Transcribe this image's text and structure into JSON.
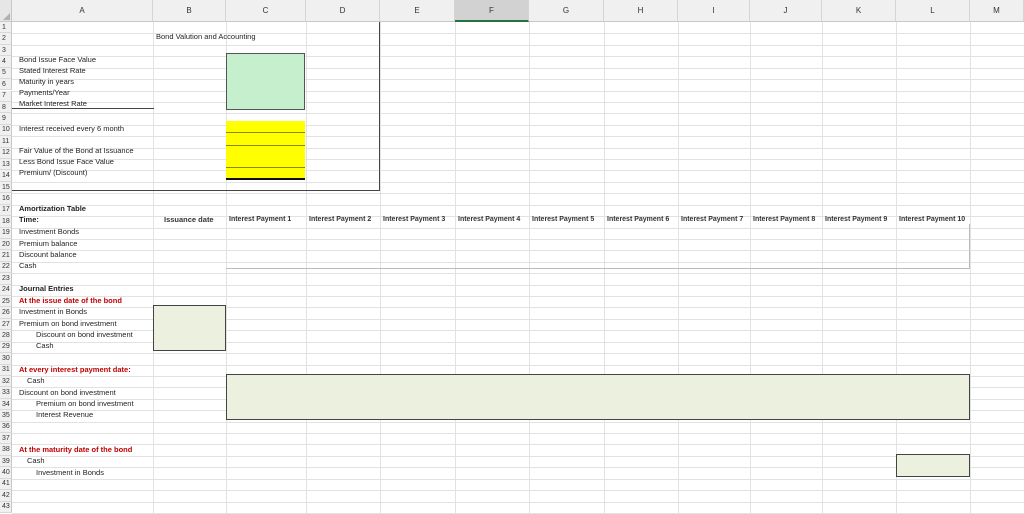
{
  "columns": [
    "A",
    "B",
    "C",
    "D",
    "E",
    "F",
    "G",
    "H",
    "I",
    "J",
    "K",
    "L",
    "M"
  ],
  "selected_column": "F",
  "rows": [
    "1",
    "2",
    "3",
    "4",
    "5",
    "6",
    "7",
    "8",
    "9",
    "10",
    "11",
    "12",
    "13",
    "14",
    "15",
    "16",
    "17",
    "18",
    "19",
    "20",
    "21",
    "22",
    "23",
    "24",
    "25",
    "26",
    "27",
    "28",
    "29",
    "30",
    "31",
    "32",
    "33",
    "34",
    "35",
    "36",
    "37",
    "38",
    "39",
    "40",
    "41",
    "42",
    "43"
  ],
  "sheet": {
    "title": "Bond Valution and Accounting",
    "inputs": {
      "face_value_label": "Bond Issue Face Value",
      "stated_rate_label": "Stated Interest Rate",
      "maturity_label": "Maturity in years",
      "payments_label": "Payments/Year",
      "market_rate_label": "Market Interest Rate"
    },
    "calcs": {
      "interest_label": "Interest received every 6 month",
      "fair_value_label": "Fair Value of the Bond at Issuance",
      "less_face_label": "Less Bond Issue Face Value",
      "premium_label": "Premium/ (Discount)"
    },
    "amortization": {
      "heading": "Amortization Table",
      "time_label": "Time:",
      "row_labels": [
        "Investment Bonds",
        "Premium balance",
        "Discount balance",
        "Cash"
      ],
      "issuance_label": "Issuance date",
      "payment_headers": [
        "Interest Payment  1",
        "Interest Payment  2",
        "Interest Payment  3",
        "Interest Payment  4",
        "Interest Payment  5",
        "Interest Payment  6",
        "Interest Payment  7",
        "Interest Payment  8",
        "Interest Payment  9",
        "Interest Payment  10"
      ]
    },
    "journal": {
      "heading": "Journal Entries",
      "issue_heading": "At the issue date of the bond",
      "issue_lines": [
        "Investment in Bonds",
        "Premium on bond investment",
        "Discount on bond investment",
        "Cash"
      ],
      "interest_heading": "At every interest payment date:",
      "interest_lines": [
        "Cash",
        "Discount on bond investment",
        "Premium on bond investment",
        "Interest Revenue"
      ],
      "maturity_heading": "At the maturity date of the bond",
      "maturity_lines": [
        "Cash",
        "Investment in Bonds"
      ]
    }
  },
  "colors": {
    "input_fill": "#c6efce",
    "calc_fill": "#ffff00",
    "journal_fill": "#ebf1de",
    "heading_red": "#c00000",
    "selected_header": "#217346"
  }
}
